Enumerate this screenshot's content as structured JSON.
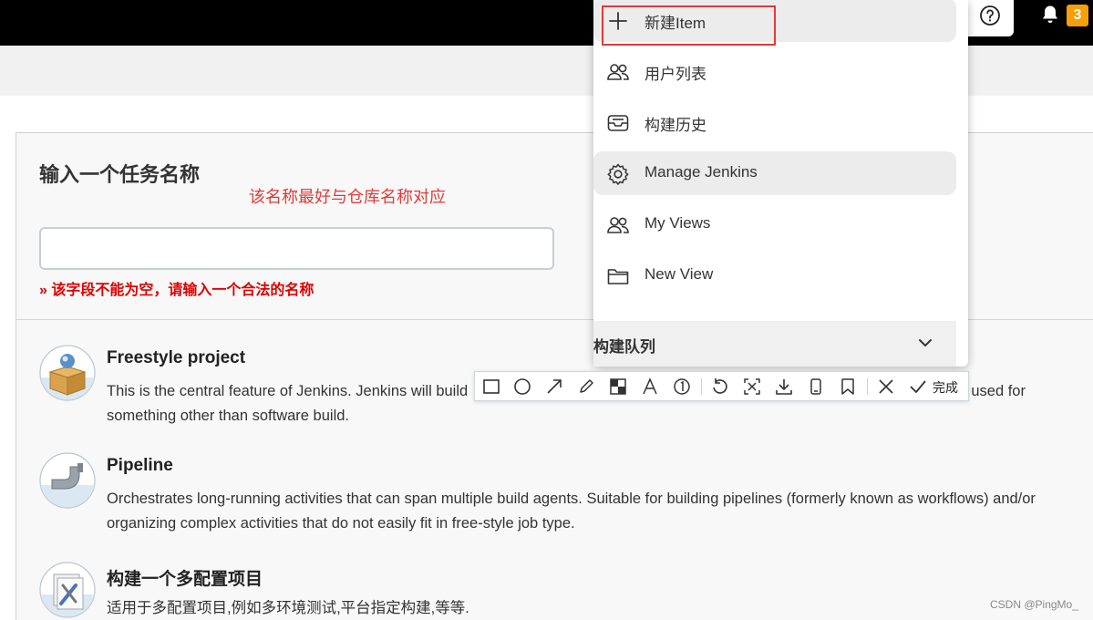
{
  "header": {
    "help_icon": "question-circle-icon",
    "bell_icon": "bell-icon",
    "notification_count": "3",
    "accent_color": "#f5a00a"
  },
  "form": {
    "title": "输入一个任务名称",
    "hint": "该名称最好与仓库名称对应",
    "name_value": "",
    "error": "» 该字段不能为空，请输入一个合法的名称"
  },
  "jobs": [
    {
      "title": "Freestyle project",
      "desc_left": "This is the central feature of Jenkins. Jenkins will build",
      "desc_right": "even used for",
      "desc_line2": "something other than software build.",
      "icon": "freestyle-box-icon"
    },
    {
      "title": "Pipeline",
      "desc": "Orchestrates long-running activities that can span multiple build agents. Suitable for building pipelines (formerly known as workflows) and/or organizing complex activities that do not easily fit in free-style job type.",
      "icon": "pipe-icon"
    },
    {
      "title": "构建一个多配置项目",
      "desc": "适用于多配置项目,例如多环境测试,平台指定构建,等等.",
      "icon": "tools-icon"
    }
  ],
  "menu": {
    "items": [
      {
        "label": "新建Item",
        "icon": "plus-icon"
      },
      {
        "label": "用户列表",
        "icon": "users-icon"
      },
      {
        "label": "构建历史",
        "icon": "inbox-icon"
      },
      {
        "label": "Manage Jenkins",
        "icon": "gear-icon"
      },
      {
        "label": "My Views",
        "icon": "users-icon"
      },
      {
        "label": "New View",
        "icon": "folder-icon"
      }
    ],
    "queue_label": "构建队列"
  },
  "toolbar": {
    "done_label": "完成",
    "tools": [
      "rectangle-icon",
      "ellipse-icon",
      "arrow-icon",
      "pen-icon",
      "mosaic-icon",
      "text-icon",
      "number-icon",
      "undo-icon",
      "ocr-icon",
      "download-icon",
      "pin-icon",
      "bookmark-icon",
      "close-icon",
      "check-icon"
    ]
  },
  "watermark": "CSDN @PingMo_"
}
